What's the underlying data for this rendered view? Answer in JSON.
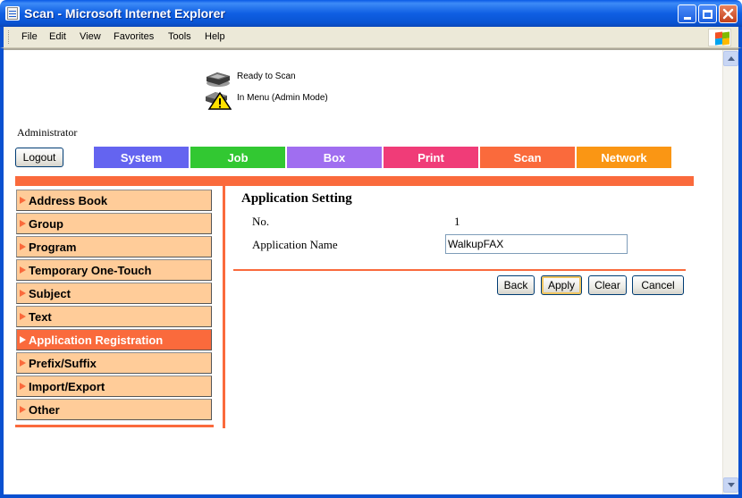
{
  "window": {
    "title": "Scan - Microsoft Internet Explorer"
  },
  "menu": {
    "items": [
      "File",
      "Edit",
      "View",
      "Favorites",
      "Tools",
      "Help"
    ]
  },
  "status": {
    "ready": "Ready to Scan",
    "mode": "In Menu (Admin Mode)"
  },
  "user": {
    "label": "Administrator",
    "logout": "Logout"
  },
  "tabs": [
    {
      "label": "System",
      "color": "#6464f0"
    },
    {
      "label": "Job",
      "color": "#32c832"
    },
    {
      "label": "Box",
      "color": "#a06ef0"
    },
    {
      "label": "Print",
      "color": "#f03c78"
    },
    {
      "label": "Scan",
      "color": "#fa6a3c"
    },
    {
      "label": "Network",
      "color": "#fa9614"
    }
  ],
  "sidebar": {
    "items": [
      {
        "label": "Address Book",
        "active": false
      },
      {
        "label": "Group",
        "active": false
      },
      {
        "label": "Program",
        "active": false
      },
      {
        "label": "Temporary One-Touch",
        "active": false
      },
      {
        "label": "Subject",
        "active": false
      },
      {
        "label": "Text",
        "active": false
      },
      {
        "label": "Application Registration",
        "active": true
      },
      {
        "label": "Prefix/Suffix",
        "active": false
      },
      {
        "label": "Import/Export",
        "active": false
      },
      {
        "label": "Other",
        "active": false
      }
    ]
  },
  "form": {
    "title": "Application Setting",
    "no_label": "No.",
    "no_value": "1",
    "name_label": "Application Name",
    "name_value": "WalkupFAX"
  },
  "buttons": {
    "back": "Back",
    "apply": "Apply",
    "clear": "Clear",
    "cancel": "Cancel"
  },
  "colors": {
    "accent": "#fa6a3c",
    "sidebar_bg": "#ffcc99"
  }
}
